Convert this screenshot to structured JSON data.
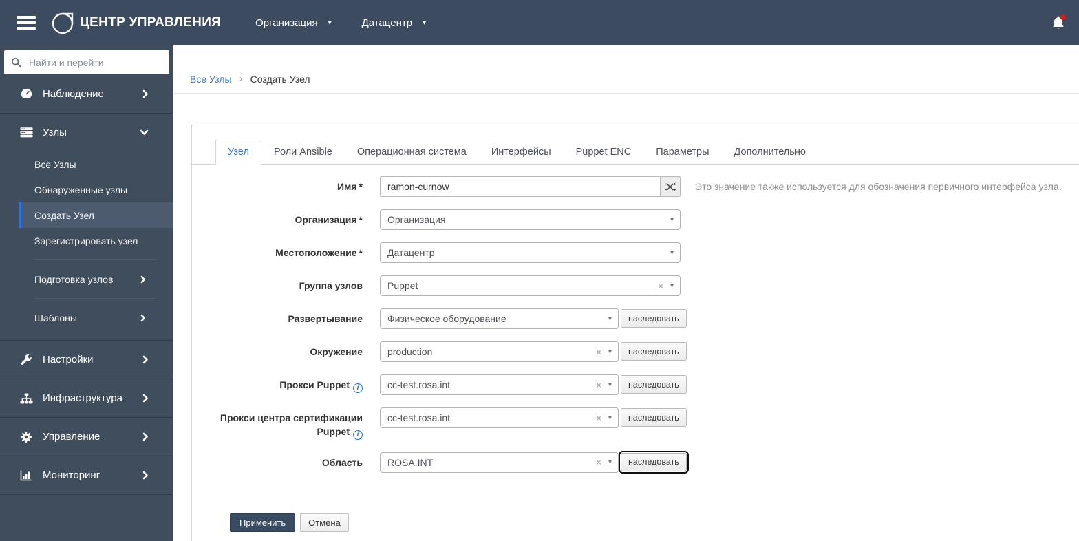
{
  "colors": {
    "header_bg": "#3d4b61",
    "sidebar_bg": "#404d5c",
    "active_item_accent": "#2175f5",
    "link_blue": "#3a77c2",
    "primary_button_bg": "#394b61",
    "notification_badge_red": "#c9201d"
  },
  "icons": {
    "caret": "▾",
    "clear": "×",
    "breadcrumb_separator": "›",
    "required_mark": "*",
    "info": "i"
  },
  "header": {
    "title": "ЦЕНТР УПРАВЛЕНИЯ",
    "org_dropdown": "Организация",
    "location_dropdown": "Датацентр"
  },
  "sidebar": {
    "search_placeholder": "Найти и перейти",
    "items": [
      {
        "label": "Наблюдение",
        "icon": "gauge-icon"
      },
      {
        "label": "Узлы",
        "icon": "servers-icon",
        "expanded": true,
        "children": [
          "Все Узлы",
          "Обнаруженные узлы",
          "Создать Узел",
          "Зарегистрировать узел",
          "Подготовка узлов",
          "Шаблоны"
        ],
        "active_child": "Создать Узел"
      },
      {
        "label": "Настройки",
        "icon": "wrench-icon"
      },
      {
        "label": "Инфраструктура",
        "icon": "sitemap-icon"
      },
      {
        "label": "Управление",
        "icon": "gear-icon"
      },
      {
        "label": "Мониторинг",
        "icon": "chart-icon"
      }
    ]
  },
  "breadcrumb": {
    "items": [
      "Все Узлы",
      "Создать Узел"
    ]
  },
  "tabs": [
    {
      "label": "Узел",
      "active": true
    },
    {
      "label": "Роли Ansible"
    },
    {
      "label": "Операционная система"
    },
    {
      "label": "Интерфейсы"
    },
    {
      "label": "Puppet ENC"
    },
    {
      "label": "Параметры"
    },
    {
      "label": "Дополнительно"
    }
  ],
  "form": {
    "inherit_label": "наследовать",
    "submit_label": "Применить",
    "cancel_label": "Отмена",
    "fields": [
      {
        "label": "Имя",
        "required": true,
        "value": "ramon-curnow",
        "help": "Это значение также используется для обозначения первичного интерфейса узла."
      },
      {
        "label": "Организация",
        "required": true,
        "value": "Организация"
      },
      {
        "label": "Местоположение",
        "required": true,
        "value": "Датацентр"
      },
      {
        "label": "Группа узлов",
        "value": "Puppet",
        "clearable": true
      },
      {
        "label": "Развертывание",
        "value": "Физическое оборудование",
        "inherit": true
      },
      {
        "label": "Окружение",
        "value": "production",
        "clearable": true,
        "inherit": true
      },
      {
        "label": "Прокси Puppet",
        "value": "cc-test.rosa.int",
        "clearable": true,
        "inherit": true,
        "info": true
      },
      {
        "label": "Прокси центра сертификации Puppet",
        "value": "cc-test.rosa.int",
        "clearable": true,
        "inherit": true,
        "info": true
      },
      {
        "label": "Область",
        "value": "ROSA.INT",
        "clearable": true,
        "inherit": true,
        "inherit_focused": true
      }
    ]
  }
}
